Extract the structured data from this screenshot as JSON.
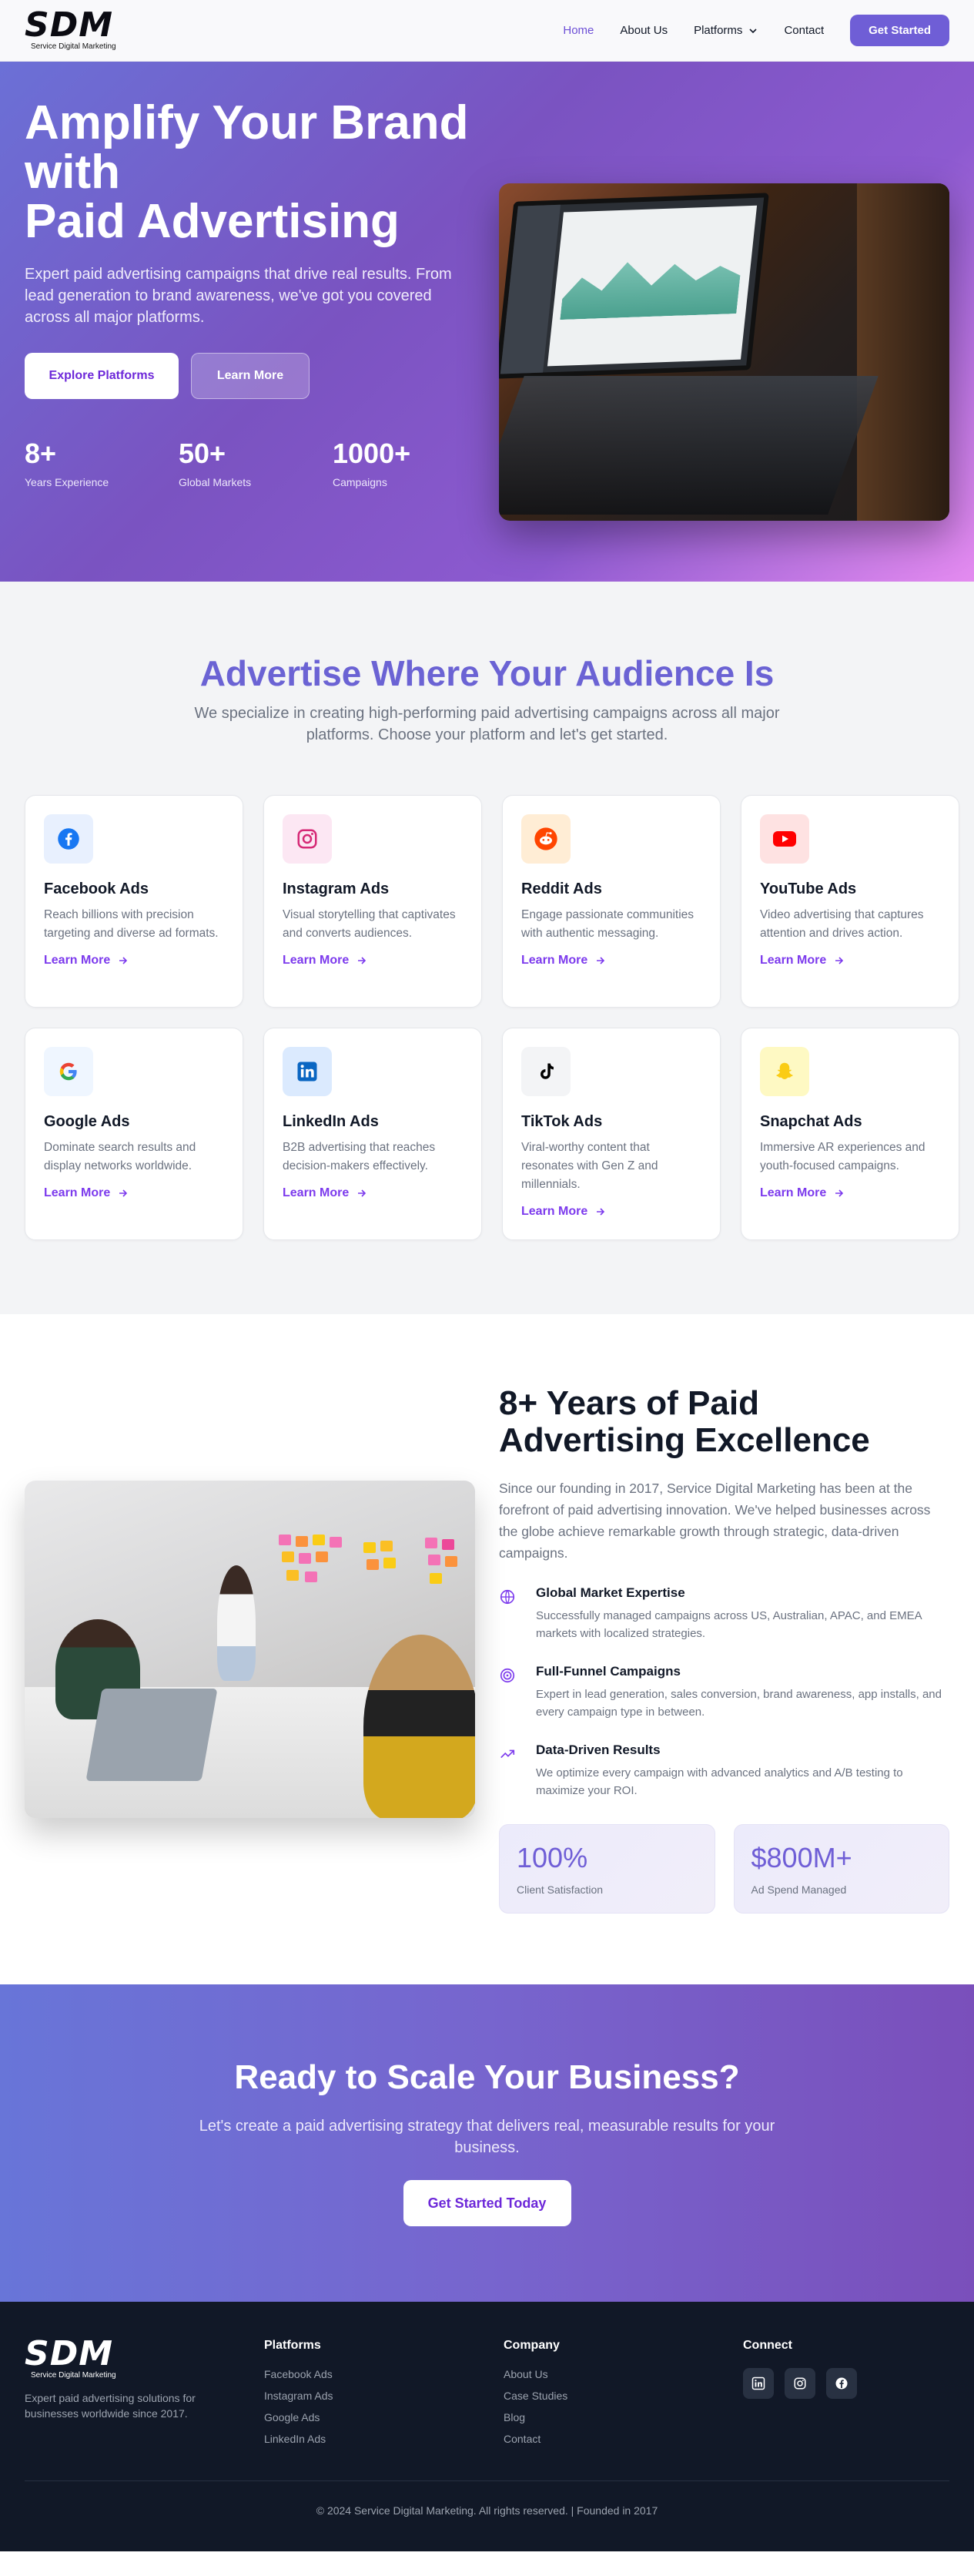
{
  "header": {
    "logo_text": "SDM",
    "logo_sub": "Service Digital Marketing",
    "nav": {
      "home": "Home",
      "about": "About Us",
      "platforms": "Platforms",
      "contact": "Contact"
    },
    "cta": "Get Started"
  },
  "hero": {
    "title_line1": "Amplify Your Brand",
    "title_line2": "with",
    "title_line3": "Paid Advertising",
    "description": "Expert paid advertising campaigns that drive real results. From lead generation to brand awareness, we've got you covered across all major platforms.",
    "btn_explore": "Explore Platforms",
    "btn_learn": "Learn More",
    "stats": [
      {
        "value": "8+",
        "label": "Years Experience"
      },
      {
        "value": "50+",
        "label": "Global Markets"
      },
      {
        "value": "1000+",
        "label": "Campaigns"
      }
    ]
  },
  "platforms": {
    "title": "Advertise Where Your Audience Is",
    "subtitle": "We specialize in creating high-performing paid advertising campaigns across all major platforms. Choose your platform and let's get started.",
    "learn_more": "Learn More",
    "cards": [
      {
        "icon": "facebook-icon",
        "name": "Facebook Ads",
        "desc": "Reach billions with precision targeting and diverse ad formats.",
        "color": "#1877f2",
        "bg": "#e8f0fe"
      },
      {
        "icon": "instagram-icon",
        "name": "Instagram Ads",
        "desc": "Visual storytelling that captivates and converts audiences.",
        "color": "#d62976",
        "bg": "#fce7f3"
      },
      {
        "icon": "reddit-icon",
        "name": "Reddit Ads",
        "desc": "Engage passionate communities with authentic messaging.",
        "color": "#ff4500",
        "bg": "#ffedd5"
      },
      {
        "icon": "youtube-icon",
        "name": "YouTube Ads",
        "desc": "Video advertising that captures attention and drives action.",
        "color": "#ff0000",
        "bg": "#fee2e2"
      },
      {
        "icon": "google-icon",
        "name": "Google Ads",
        "desc": "Dominate search results and display networks worldwide.",
        "color": "#4285f4",
        "bg": "#eff6ff"
      },
      {
        "icon": "linkedin-icon",
        "name": "LinkedIn Ads",
        "desc": "B2B advertising that reaches decision-makers effectively.",
        "color": "#0a66c2",
        "bg": "#dbeafe"
      },
      {
        "icon": "tiktok-icon",
        "name": "TikTok Ads",
        "desc": "Viral-worthy content that resonates with Gen Z and millennials.",
        "color": "#000000",
        "bg": "#f3f4f6"
      },
      {
        "icon": "snapchat-icon",
        "name": "Snapchat Ads",
        "desc": "Immersive AR experiences and youth-focused campaigns.",
        "color": "#facc15",
        "bg": "#fef9c3"
      }
    ]
  },
  "experience": {
    "title": "8+ Years of Paid Advertising Excellence",
    "description": "Since our founding in 2017, Service Digital Marketing has been at the forefront of paid advertising innovation. We've helped businesses across the globe achieve remarkable growth through strategic, data-driven campaigns.",
    "features": [
      {
        "icon": "globe-icon",
        "title": "Global Market Expertise",
        "desc": "Successfully managed campaigns across US, Australian, APAC, and EMEA markets with localized strategies."
      },
      {
        "icon": "target-icon",
        "title": "Full-Funnel Campaigns",
        "desc": "Expert in lead generation, sales conversion, brand awareness, app installs, and every campaign type in between."
      },
      {
        "icon": "trending-up-icon",
        "title": "Data-Driven Results",
        "desc": "We optimize every campaign with advanced analytics and A/B testing to maximize your ROI."
      }
    ],
    "metrics": [
      {
        "value": "100%",
        "label": "Client Satisfaction"
      },
      {
        "value": "$800M+",
        "label": "Ad Spend Managed"
      }
    ]
  },
  "cta": {
    "title": "Ready to Scale Your Business?",
    "text": "Let's create a paid advertising strategy that delivers real, measurable results for your business.",
    "button": "Get Started Today"
  },
  "footer": {
    "logo_text": "SDM",
    "logo_sub": "Service Digital Marketing",
    "desc": "Expert paid advertising solutions for businesses worldwide since 2017.",
    "platforms_title": "Platforms",
    "platforms": [
      "Facebook Ads",
      "Instagram Ads",
      "Google Ads",
      "LinkedIn Ads"
    ],
    "company_title": "Company",
    "company": [
      "About Us",
      "Case Studies",
      "Blog",
      "Contact"
    ],
    "connect_title": "Connect",
    "copyright": "© 2024 Service Digital Marketing. All rights reserved. | Founded in 2017"
  }
}
